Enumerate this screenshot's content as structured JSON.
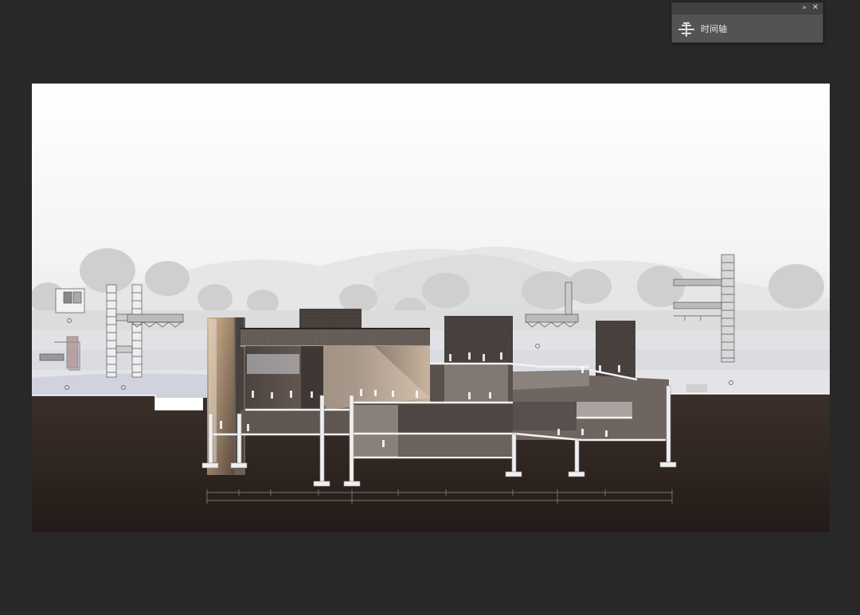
{
  "panel": {
    "collapse_icon": "double-chevron-right-icon",
    "close_icon": "close-icon",
    "items": [
      {
        "label": "时间轴",
        "icon": "timeline-icon"
      }
    ]
  },
  "canvas": {
    "content": "architectural-section-drawing"
  },
  "colors": {
    "workspace_bg": "#282828",
    "panel_bg": "#535353",
    "panel_header": "#424242",
    "ground": "#2e2420",
    "sky": "#ffffff"
  }
}
